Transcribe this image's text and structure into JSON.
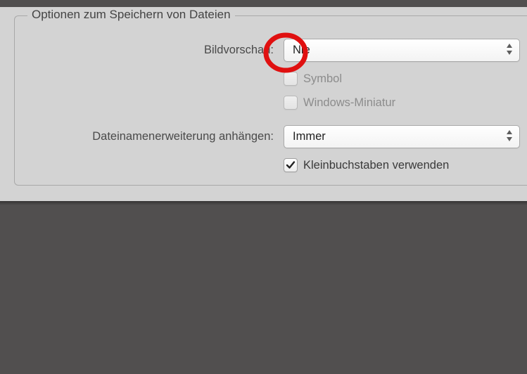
{
  "section": {
    "legend": "Optionen zum Speichern von Dateien"
  },
  "preview": {
    "label": "Bildvorschau:",
    "value": "Nie",
    "symbol_label": "Symbol",
    "symbol_checked": false,
    "windows_thumb_label": "Windows-Miniatur",
    "windows_thumb_checked": false
  },
  "extension": {
    "label": "Dateinamenerweiterung anhängen:",
    "value": "Immer",
    "lowercase_label": "Kleinbuchstaben verwenden",
    "lowercase_checked": true
  }
}
